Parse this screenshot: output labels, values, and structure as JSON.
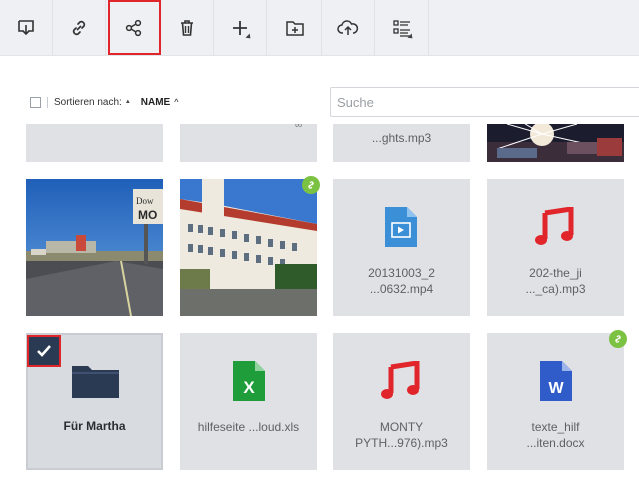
{
  "toolbar": {
    "buttons": [
      {
        "icon": "download-icon"
      },
      {
        "icon": "link-icon"
      },
      {
        "icon": "share-icon",
        "highlighted": true
      },
      {
        "icon": "trash-icon"
      },
      {
        "icon": "plus-icon",
        "label": "+"
      },
      {
        "icon": "new-folder-icon"
      },
      {
        "icon": "cloud-upload-icon"
      },
      {
        "icon": "list-view-icon"
      }
    ],
    "highlight_color": "#e0252b"
  },
  "sort": {
    "label": "Sortieren nach:",
    "field": "NAME"
  },
  "search": {
    "placeholder": "Suche",
    "value": ""
  },
  "files": {
    "row0": [
      {
        "label": ""
      },
      {
        "label": ""
      },
      {
        "label": "...ghts.mp3"
      },
      {
        "label": ""
      }
    ],
    "row1": [
      {
        "type": "image",
        "label": ""
      },
      {
        "type": "image",
        "label": "",
        "shared": true
      },
      {
        "type": "video",
        "line1": "20131003_2",
        "line2": "...0632.mp4"
      },
      {
        "type": "audio",
        "line1": "202-the_ji",
        "line2": "..._ca).mp3"
      }
    ],
    "row2": [
      {
        "type": "folder",
        "label": "Für Martha",
        "selected": true
      },
      {
        "type": "excel",
        "label": "hilfeseite ...loud.xls"
      },
      {
        "type": "audio",
        "line1": "MONTY",
        "line2": "PYTH...976).mp3"
      },
      {
        "type": "word",
        "line1": "texte_hilf",
        "line2": "...iten.docx",
        "shared": true
      }
    ]
  },
  "colors": {
    "tile_bg": "#dfe1e4",
    "audio_red": "#e0252b",
    "video_blue": "#3b8fd6",
    "excel_green": "#1f9d3a",
    "word_blue": "#2f5cc9",
    "folder_navy": "#2a3a52",
    "shared_green": "#7cc242"
  }
}
